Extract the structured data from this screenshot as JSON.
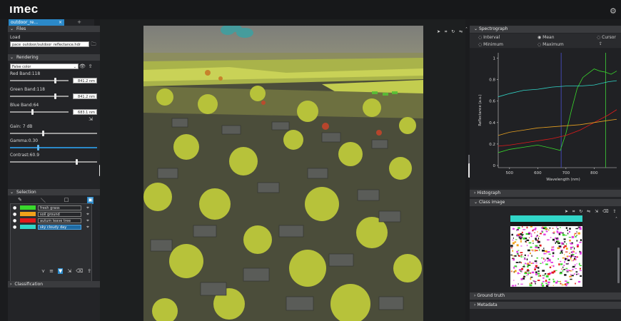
{
  "app": {
    "logo": "ımec",
    "settings_icon": "gear-icon"
  },
  "tabs": [
    {
      "label": "outdoor_re...",
      "close": "×"
    }
  ],
  "tab_add": "+",
  "left": {
    "files": {
      "header": "Files",
      "load_label": "Load",
      "path": "pace_outdoor/outdoor_reflectance.hdr"
    },
    "rendering": {
      "header": "Rendering",
      "mode": "False color",
      "red_label": "Red Band:118",
      "red_value": "841.2 nm",
      "red_fraction": 0.77,
      "green_label": "Green Band:118",
      "green_value": "841.2 nm",
      "green_fraction": 0.77,
      "blue_label": "Blue Band:64",
      "blue_value": "683.1 nm",
      "blue_fraction": 0.38,
      "gain_label": "Gain: 7 dB",
      "gain_fraction": 0.38,
      "gamma_label": "Gamma:0.30",
      "gamma_fraction": 0.32,
      "contrast_label": "Contrast:60.9",
      "contrast_fraction": 0.76
    },
    "selection": {
      "header": "Selection",
      "items": [
        {
          "name": "fresh grass",
          "color": "#39d82c"
        },
        {
          "name": "soil ground",
          "color": "#f1a11b"
        },
        {
          "name": "autum leave tree",
          "color": "#e11a1a"
        },
        {
          "name": "sky cloudy day",
          "color": "#31d6c8"
        }
      ],
      "active_index": 3
    },
    "classification": {
      "header": "Classification"
    }
  },
  "right": {
    "spectrograph": {
      "header": "Spectrograph",
      "options": [
        "Interval",
        "Mean",
        "Cursor",
        "Minimum",
        "Maximum"
      ]
    },
    "histograph": {
      "header": "Histograph"
    },
    "class_image": {
      "header": "Class image"
    },
    "ground_truth": {
      "header": "Ground truth"
    },
    "metadata": {
      "header": "Metadata"
    }
  },
  "chart_data": {
    "type": "line",
    "xlabel": "Wavelength (nm)",
    "ylabel": "Reflectance (a.u.)",
    "xlim": [
      460,
      880
    ],
    "ylim": [
      -0.02,
      1.05
    ],
    "x_ticks": [
      500,
      600,
      700,
      800
    ],
    "y_ticks": [
      0,
      0.2,
      0.4,
      0.6,
      0.8,
      1
    ],
    "markers": [
      {
        "x": 683,
        "color": "#4a4fd0"
      },
      {
        "x": 841,
        "color": "#3fcf3a"
      }
    ],
    "series": [
      {
        "color": "#39d82c",
        "x": [
          460,
          500,
          550,
          600,
          650,
          680,
          700,
          720,
          740,
          760,
          780,
          800,
          820,
          840,
          860,
          880
        ],
        "y": [
          0.12,
          0.15,
          0.17,
          0.19,
          0.16,
          0.14,
          0.3,
          0.52,
          0.72,
          0.82,
          0.86,
          0.9,
          0.88,
          0.87,
          0.85,
          0.88
        ]
      },
      {
        "color": "#e11a1a",
        "x": [
          460,
          500,
          550,
          600,
          650,
          700,
          750,
          800,
          850,
          880
        ],
        "y": [
          0.18,
          0.19,
          0.21,
          0.23,
          0.25,
          0.28,
          0.33,
          0.4,
          0.47,
          0.52
        ]
      },
      {
        "color": "#e6a020",
        "x": [
          460,
          500,
          550,
          600,
          650,
          700,
          750,
          800,
          850,
          880
        ],
        "y": [
          0.28,
          0.31,
          0.33,
          0.35,
          0.36,
          0.37,
          0.38,
          0.4,
          0.42,
          0.43
        ]
      },
      {
        "color": "#31d6c8",
        "x": [
          460,
          500,
          550,
          600,
          650,
          700,
          750,
          800,
          850,
          880
        ],
        "y": [
          0.64,
          0.67,
          0.7,
          0.71,
          0.73,
          0.74,
          0.74,
          0.75,
          0.78,
          0.79
        ]
      }
    ]
  }
}
